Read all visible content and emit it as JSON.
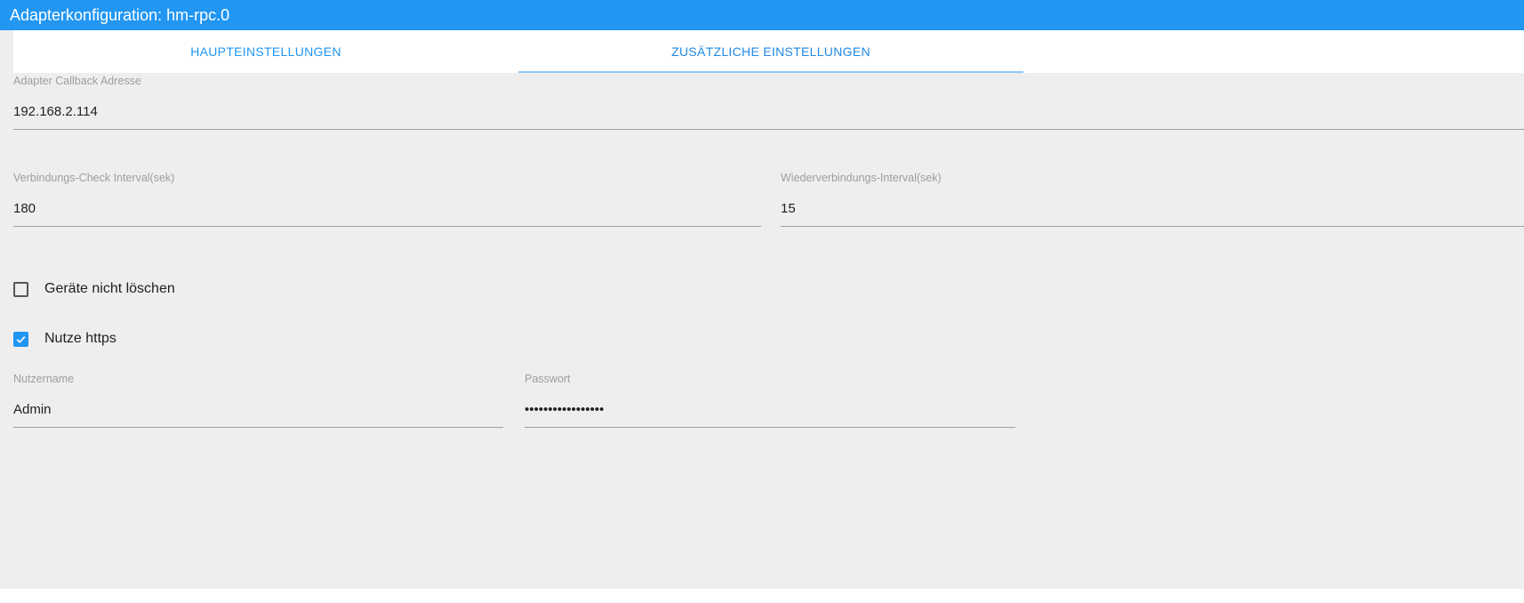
{
  "window": {
    "title": "Adapterkonfiguration: hm-rpc.0"
  },
  "tabs": [
    {
      "label": "HAUPTEINSTELLUNGEN",
      "active": false
    },
    {
      "label": "ZUSÄTZLICHE EINSTELLUNGEN",
      "active": true
    }
  ],
  "form": {
    "callback_address": {
      "label": "Adapter Callback Adresse",
      "value": "192.168.2.114"
    },
    "check_interval": {
      "label": "Verbindungs-Check Interval(sek)",
      "value": "180"
    },
    "reconnect_interval": {
      "label": "Wiederverbindungs-Interval(sek)",
      "value": "15"
    },
    "dont_delete_devices": {
      "label": "Geräte nicht löschen",
      "checked": false
    },
    "use_https": {
      "label": "Nutze https",
      "checked": true
    },
    "username": {
      "label": "Nutzername",
      "value": "Admin"
    },
    "password": {
      "label": "Passwort",
      "value": "•••••••••••••••••"
    }
  },
  "colors": {
    "accent": "#2196f3",
    "panel_background": "#eeeeee",
    "label_gray": "#9e9e9e"
  }
}
